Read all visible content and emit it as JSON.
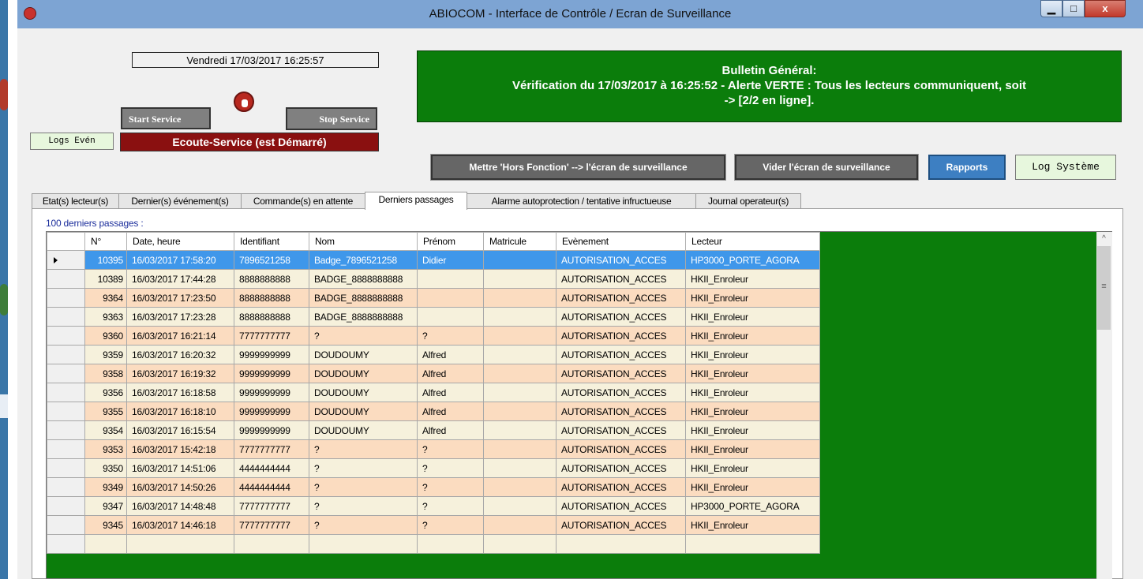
{
  "window": {
    "title": "ABIOCOM - Interface de Contrôle / Ecran de Surveillance",
    "minimize_label": "▁",
    "maximize_label": "□",
    "close_label": "x"
  },
  "header": {
    "datetime": "Vendredi 17/03/2017 16:25:57",
    "start_label": "Start Service",
    "stop_label": "Stop Service",
    "logs_even_label": "Logs Evén",
    "service_status": "Ecoute-Service (est Démarré)"
  },
  "bulletin": {
    "title": "Bulletin Général:",
    "line1": "Vérification du 17/03/2017 à 16:25:52 - Alerte VERTE : Tous les lecteurs communiquent, soit",
    "line2": "-> [2/2 en ligne]."
  },
  "toolbar": {
    "hors_fonction_label": "Mettre 'Hors Fonction' --> l'écran de surveillance",
    "vider_label": "Vider l'écran de surveillance",
    "rapports_label": "Rapports",
    "log_systeme_label": "Log Système"
  },
  "tabs": [
    {
      "label": "Etat(s) lecteur(s)"
    },
    {
      "label": "Dernier(s) événement(s)"
    },
    {
      "label": "Commande(s) en attente"
    },
    {
      "label": "Derniers passages"
    },
    {
      "label": "Alarme autoprotection  /  tentative infructueuse"
    },
    {
      "label": "Journal operateur(s)"
    }
  ],
  "panel": {
    "caption": "100 derniers passages :"
  },
  "grid": {
    "columns": [
      "N°",
      "Date, heure",
      "Identifiant",
      "Nom",
      "Prénom",
      "Matricule",
      "Evènement",
      "Lecteur"
    ],
    "rows": [
      [
        "10395",
        "16/03/2017 17:58:20",
        "7896521258",
        "Badge_7896521258",
        "Didier",
        "",
        "AUTORISATION_ACCES",
        "HP3000_PORTE_AGORA"
      ],
      [
        "10389",
        "16/03/2017 17:44:28",
        "8888888888",
        "BADGE_8888888888",
        "",
        "",
        "AUTORISATION_ACCES",
        "HKII_Enroleur"
      ],
      [
        "9364",
        "16/03/2017 17:23:50",
        "8888888888",
        "BADGE_8888888888",
        "",
        "",
        "AUTORISATION_ACCES",
        "HKII_Enroleur"
      ],
      [
        "9363",
        "16/03/2017 17:23:28",
        "8888888888",
        "BADGE_8888888888",
        "",
        "",
        "AUTORISATION_ACCES",
        "HKII_Enroleur"
      ],
      [
        "9360",
        "16/03/2017 16:21:14",
        "7777777777",
        "?",
        "?",
        "",
        "AUTORISATION_ACCES",
        "HKII_Enroleur"
      ],
      [
        "9359",
        "16/03/2017 16:20:32",
        "9999999999",
        "DOUDOUMY",
        "Alfred",
        "",
        "AUTORISATION_ACCES",
        "HKII_Enroleur"
      ],
      [
        "9358",
        "16/03/2017 16:19:32",
        "9999999999",
        "DOUDOUMY",
        "Alfred",
        "",
        "AUTORISATION_ACCES",
        "HKII_Enroleur"
      ],
      [
        "9356",
        "16/03/2017 16:18:58",
        "9999999999",
        "DOUDOUMY",
        "Alfred",
        "",
        "AUTORISATION_ACCES",
        "HKII_Enroleur"
      ],
      [
        "9355",
        "16/03/2017 16:18:10",
        "9999999999",
        "DOUDOUMY",
        "Alfred",
        "",
        "AUTORISATION_ACCES",
        "HKII_Enroleur"
      ],
      [
        "9354",
        "16/03/2017 16:15:54",
        "9999999999",
        "DOUDOUMY",
        "Alfred",
        "",
        "AUTORISATION_ACCES",
        "HKII_Enroleur"
      ],
      [
        "9353",
        "16/03/2017 15:42:18",
        "7777777777",
        "?",
        "?",
        "",
        "AUTORISATION_ACCES",
        "HKII_Enroleur"
      ],
      [
        "9350",
        "16/03/2017 14:51:06",
        "4444444444",
        "?",
        "?",
        "",
        "AUTORISATION_ACCES",
        "HKII_Enroleur"
      ],
      [
        "9349",
        "16/03/2017 14:50:26",
        "4444444444",
        "?",
        "?",
        "",
        "AUTORISATION_ACCES",
        "HKII_Enroleur"
      ],
      [
        "9347",
        "16/03/2017 14:48:48",
        "7777777777",
        "?",
        "?",
        "",
        "AUTORISATION_ACCES",
        "HP3000_PORTE_AGORA"
      ],
      [
        "9345",
        "16/03/2017 14:46:18",
        "7777777777",
        "?",
        "?",
        "",
        "AUTORISATION_ACCES",
        "HKII_Enroleur"
      ],
      [
        "",
        "",
        "",
        "",
        "",
        "",
        "",
        ""
      ]
    ],
    "selected_row": 0
  },
  "colors": {
    "bulletin_bg": "#0b7d0b",
    "status_bg": "#8a1010",
    "selected_row": "#3f97ea",
    "row_even": "#f6f1dc",
    "row_odd": "#fbdcc0",
    "rapports_bg": "#3d7fc2"
  }
}
